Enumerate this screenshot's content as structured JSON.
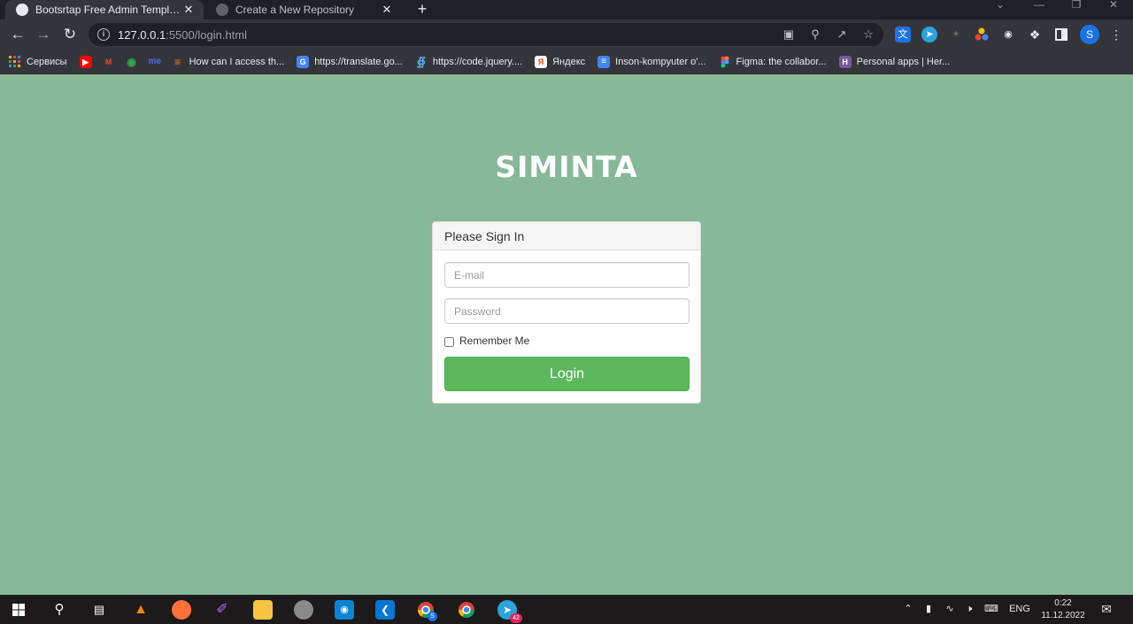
{
  "browser": {
    "tabs": [
      {
        "title": "Bootsrtap Free Admin Template -",
        "active": true
      },
      {
        "title": "Create a New Repository",
        "active": false
      }
    ],
    "new_tab_symbol": "+",
    "close_symbol": "✕",
    "address": {
      "host": "127.0.0.1",
      "path": ":5500/login.html"
    },
    "profile_initial": "S",
    "bookmarks": [
      {
        "label": "Сервисы",
        "icon": "apps-grid-icon",
        "color": "#f4b400"
      },
      {
        "label": "",
        "icon": "youtube-icon",
        "color": "#ff0000"
      },
      {
        "label": "",
        "icon": "gmail-icon",
        "color": "#ea4335"
      },
      {
        "label": "",
        "icon": "maps-icon",
        "color": "#34a853"
      },
      {
        "label": "",
        "icon": "me-icon",
        "color": "#4a6cf7"
      },
      {
        "label": "How can I access th...",
        "icon": "stackoverflow-icon",
        "color": "#f48024"
      },
      {
        "label": "https://translate.go...",
        "icon": "translate-icon",
        "color": "#4285f4"
      },
      {
        "label": "https://code.jquery....",
        "icon": "jquery-icon",
        "color": "#0769ad"
      },
      {
        "label": "Яндекс",
        "icon": "yandex-icon",
        "color": "#fc3f1d"
      },
      {
        "label": "Inson-kompyuter o'...",
        "icon": "docs-icon",
        "color": "#4285f4"
      },
      {
        "label": "Figma: the collabor...",
        "icon": "figma-icon",
        "color": "#a259ff"
      },
      {
        "label": "Personal apps | Her...",
        "icon": "heroku-icon",
        "color": "#79589f"
      }
    ]
  },
  "page": {
    "brand": "SIMINTA",
    "background": "#87b898",
    "panel_title": "Please Sign In",
    "email_placeholder": "E-mail",
    "password_placeholder": "Password",
    "remember_label": "Remember Me",
    "remember_checked": false,
    "login_label": "Login",
    "login_color": "#5cb85c"
  },
  "taskbar": {
    "language": "ENG",
    "time": "0:22",
    "date": "11.12.2022",
    "telegram_badge": "42",
    "chrome_badge": "S"
  }
}
